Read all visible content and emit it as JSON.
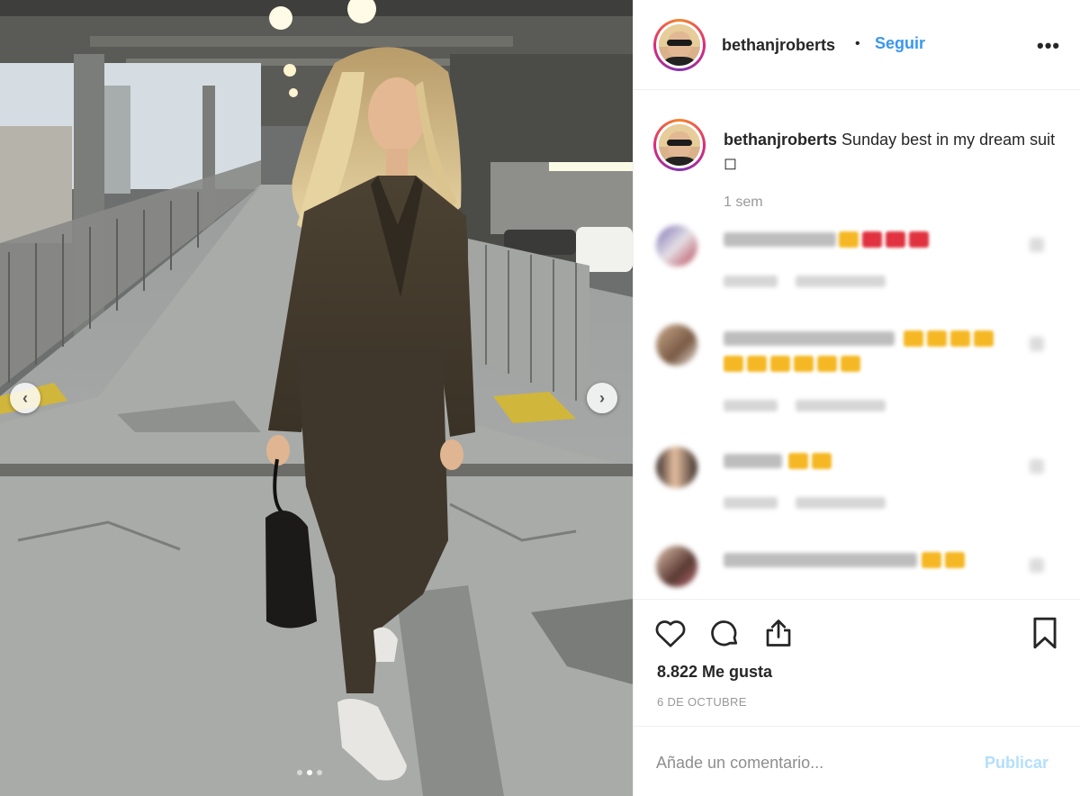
{
  "post": {
    "author": "bethanjroberts",
    "separator": "•",
    "follow_label": "Seguir",
    "more_label": "•••",
    "caption_text": "Sunday best in my dream suit ◻",
    "caption_time": "1 sem",
    "likes_text": "8.822 Me gusta",
    "date_text": "6 DE OCTUBRE",
    "comment_placeholder": "Añade un comentario...",
    "publish_label": "Publicar"
  },
  "carousel": {
    "total": 3,
    "active_index": 1
  },
  "icons": {
    "like": "heart-icon",
    "comment": "comment-bubble-icon",
    "share": "share-icon",
    "save": "bookmark-icon",
    "prev": "chevron-left-icon",
    "next": "chevron-right-icon",
    "prev_glyph": "‹",
    "next_glyph": "›"
  },
  "colors": {
    "accent": "#3897f0",
    "publish_disabled": "#b2dffc",
    "muted_text": "#999999",
    "emoji_red": "#e0323f",
    "emoji_yellow": "#f5b824"
  }
}
